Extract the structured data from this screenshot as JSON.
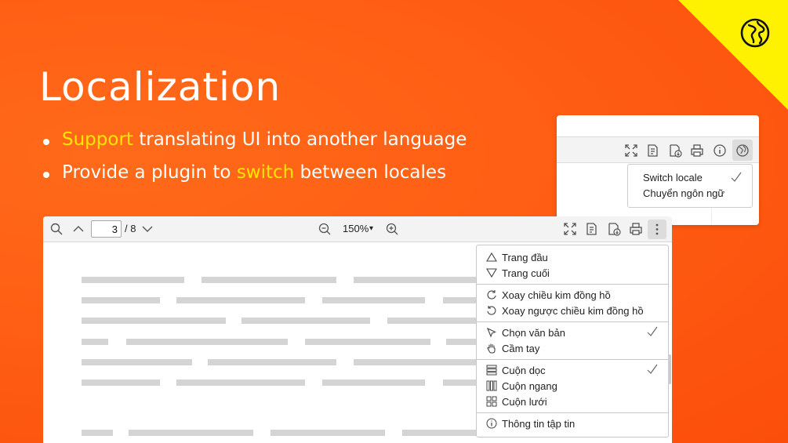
{
  "slide": {
    "title": "Localization",
    "bullet1": {
      "hl": "Support",
      "rest": " translating UI into another language"
    },
    "bullet2": {
      "pre": "Provide a plugin to ",
      "hl": "switch",
      "post": " between locales"
    }
  },
  "colors": {
    "accent": "#ffe600",
    "corner": "#fff200",
    "background": "#ff5f14"
  },
  "icons": [
    "globe-icon",
    "search-icon",
    "chevron-up-icon",
    "chevron-down-icon",
    "zoom-out-icon",
    "zoom-in-icon",
    "fullscreen-icon",
    "open-file-icon",
    "download-icon",
    "print-icon",
    "info-icon",
    "more-icon",
    "checkmark-icon"
  ],
  "mini": {
    "menu": {
      "switch_locale": "Switch locale",
      "vietnamese": "Chuyển ngôn ngữ"
    }
  },
  "viewer": {
    "current_page": "3",
    "total_pages": "/ 8",
    "zoom": "150%",
    "zoom_caret": "▾"
  },
  "menu": {
    "first_page": "Trang đầu",
    "last_page": "Trang cuối",
    "rotate_cw": "Xoay chiều kim đồng hồ",
    "rotate_ccw": "Xoay ngược chiều kim đồng hồ",
    "select_text": "Chọn văn bản",
    "hand_tool": "Cầm tay",
    "vertical_scroll": "Cuộn dọc",
    "horizontal_scroll": "Cuộn ngang",
    "wrapped_scroll": "Cuộn lưới",
    "doc_properties": "Thông tin tập tin"
  }
}
